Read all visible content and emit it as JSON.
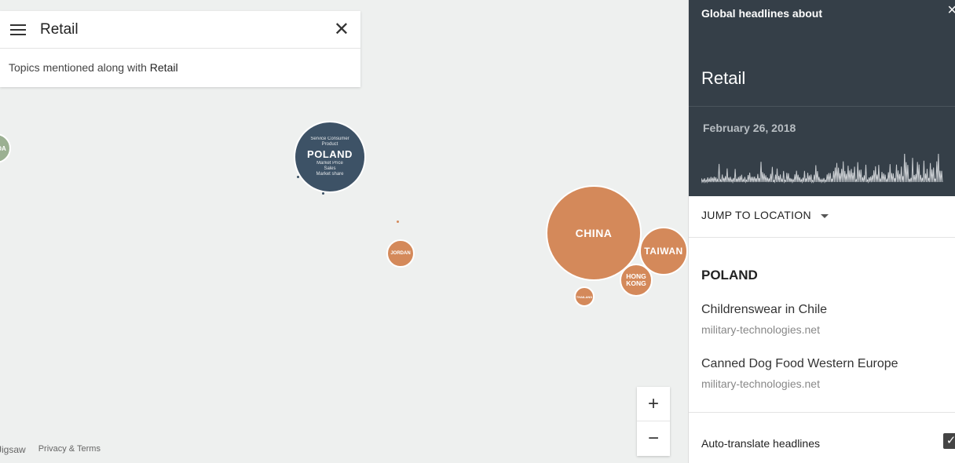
{
  "search": {
    "title": "Retail",
    "topics_prefix": "Topics mentioned along with",
    "topics_term": "Retail"
  },
  "map": {
    "bubbles": [
      {
        "id": "poland",
        "label": "POLAND",
        "color": "#3d5266"
      },
      {
        "id": "china",
        "label": "CHINA",
        "color": "#d4895a"
      },
      {
        "id": "taiwan",
        "label": "TAIWAN",
        "color": "#d4895a"
      },
      {
        "id": "hongkong",
        "label": "HONG KONG",
        "color": "#d4895a"
      },
      {
        "id": "jordan",
        "label": "JORDAN",
        "color": "#d4895a"
      },
      {
        "id": "thailand",
        "label": "THAILAND",
        "color": "#d4895a"
      },
      {
        "id": "left-edge",
        "label": "DA",
        "color": "#9bb092"
      }
    ],
    "poland_words": [
      "Service",
      "Consumer",
      "Product",
      "Price",
      "Market",
      "Sales",
      "Market share"
    ]
  },
  "footer": {
    "brand": "Jigsaw",
    "terms": "Privacy & Terms"
  },
  "zoom": {
    "in": "+",
    "out": "−"
  },
  "panel": {
    "label": "Global headlines about",
    "close": "×",
    "topic": "Retail",
    "date": "February 26, 2018",
    "jump": "JUMP TO LOCATION",
    "location": "POLAND",
    "headlines": [
      {
        "title": "Childrenswear in Chile",
        "source": "military-technologies.net"
      },
      {
        "title": "Canned Dog Food Western Europe",
        "source": "military-technologies.net"
      }
    ],
    "auto_translate": "Auto-translate headlines",
    "auto_translate_checked": true
  },
  "colors": {
    "header_bg": "#353f48",
    "accent_orange": "#d4895a",
    "accent_blue": "#3d5266"
  }
}
